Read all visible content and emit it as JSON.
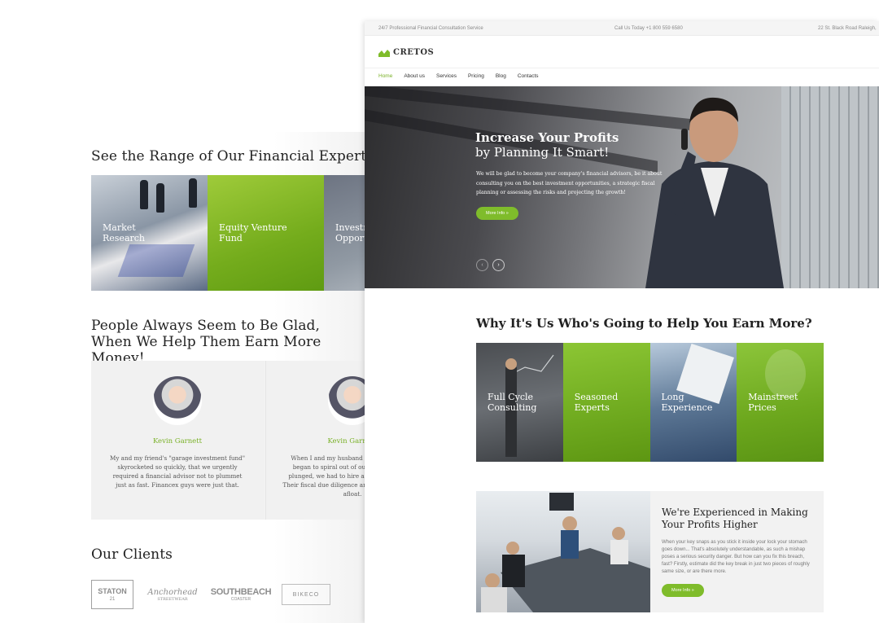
{
  "back": {
    "expertise_title": "See the Range of Our Financial Expertise",
    "expertise_tiles": [
      {
        "label": "Market Research"
      },
      {
        "label": "Equity Venture Fund"
      },
      {
        "label": "Investment Opportunities"
      }
    ],
    "testimonials_title": "People Always Seem to Be Glad, When We Help Them Earn More Money!",
    "testimonials": [
      {
        "name": "Kevin Garnett",
        "text": "My and my friend's \"garage investment fund\" skyrocketed so quickly, that we urgently required a financial advisor not to plummet just as fast. Financex guys were just that."
      },
      {
        "name": "Kevin Garnett",
        "text": "When I and my husband felt our business began to spiral out of our control, and it plunged, we had to hire a financial advisor. Their fiscal due diligence and research kept us afloat."
      }
    ],
    "clients_title": "Our Clients",
    "clients": [
      {
        "name": "STATON",
        "sub": "21"
      },
      {
        "name": "Anchorhead",
        "sub": "STREETWEAR"
      },
      {
        "name": "SOUTHBEACH",
        "sub": "COASTER"
      },
      {
        "name": "BIKECO",
        "sub": ""
      }
    ]
  },
  "front": {
    "topbar": {
      "tagline": "24/7 Professional Financial Consultation Service",
      "phone": "Call Us Today +1 800 559 6580",
      "address": "22 St. Black Road  Raleigh,"
    },
    "brand": {
      "name": "CRETOS",
      "icon": "chart-logo-icon",
      "accent": "#7fbc2b"
    },
    "nav": [
      "Home",
      "About us",
      "Services",
      "Pricing",
      "Blog",
      "Contacts"
    ],
    "nav_active": "Home",
    "hero": {
      "title_bold": "Increase Your Profits",
      "title_light": "by Planning It Smart!",
      "text": "We will be glad to become your company's financial advisors, be it about consulting you on the best investment opportunities, a strategic fiscal planning or assessing the risks and projecting the growth!",
      "button": "More Info »",
      "prev_icon": "chevron-left-icon",
      "next_icon": "chevron-right-icon"
    },
    "why_title": "Why It's Us Who's Going to Help You Earn More?",
    "why_tiles": [
      {
        "label": "Full Cycle Consulting"
      },
      {
        "label": "Seasoned Experts"
      },
      {
        "label": "Long Experience"
      },
      {
        "label": "Mainstreet Prices"
      }
    ],
    "experience": {
      "title": "We're Experienced in Making Your Profits Higher",
      "text": "When your key snaps as you stick it inside your lock your stomach goes down... That's absolutely understandable, as such a mishap poses a serious security danger. But how can you fix this breach, fast? Firstly, estimate did the key break in just two pieces of roughly same size, or are there more.",
      "button": "More Info »"
    }
  }
}
